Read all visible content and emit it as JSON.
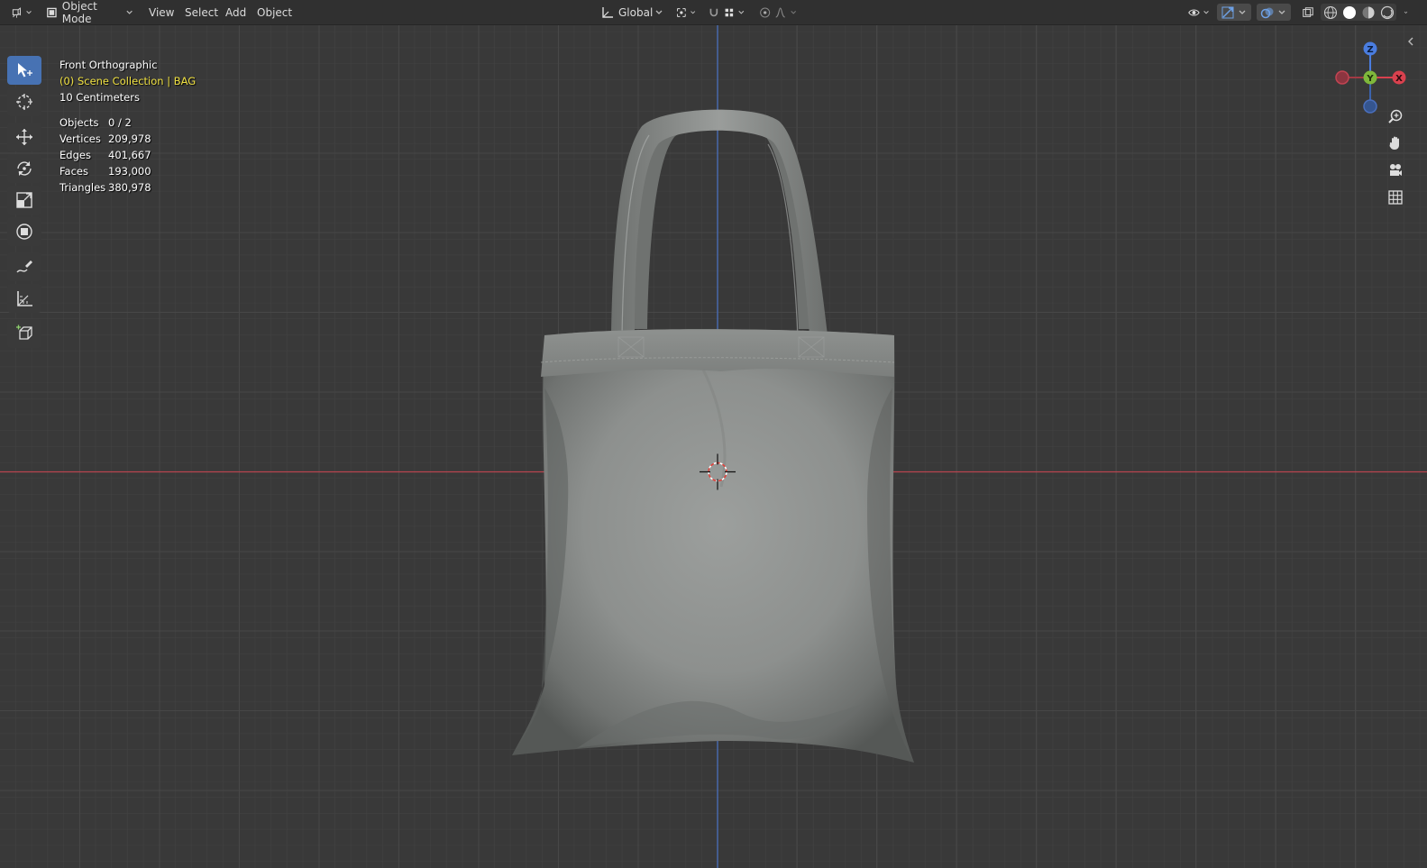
{
  "header": {
    "editor_type_icon": "viewport-editor-icon",
    "mode_label": "Object Mode",
    "menus": [
      "View",
      "Select",
      "Add",
      "Object"
    ],
    "orientation_label": "Global"
  },
  "overlay": {
    "view_name": "Front Orthographic",
    "collection": "(0) Scene Collection | BAG",
    "grid_scale": "10 Centimeters"
  },
  "stats": [
    {
      "key": "Objects",
      "value": "0 / 2"
    },
    {
      "key": "Vertices",
      "value": "209,978"
    },
    {
      "key": "Edges",
      "value": "401,667"
    },
    {
      "key": "Faces",
      "value": "193,000"
    },
    {
      "key": "Triangles",
      "value": "380,978"
    }
  ],
  "gizmo": {
    "z": "Z",
    "y": "Y",
    "x": "X"
  },
  "tools": [
    "select-box-icon",
    "cursor-icon",
    "move-icon",
    "rotate-icon",
    "scale-icon",
    "transform-icon",
    "annotate-icon",
    "measure-icon",
    "add-cube-icon"
  ],
  "colors": {
    "header_bg": "#303030",
    "viewport_bg": "#393939",
    "active_tool": "#4772b3",
    "x_axis": "#c24452",
    "z_axis": "#3f6ec2",
    "collection_text": "#f0e142"
  }
}
